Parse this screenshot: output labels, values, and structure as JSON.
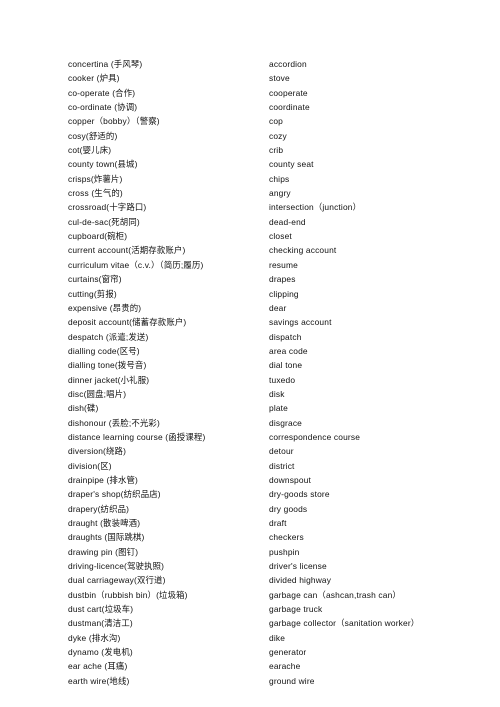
{
  "document": {
    "type": "vocabulary-list",
    "description": "British English to American English word list with Chinese glosses",
    "background_color": "#ffffff",
    "text_color": "#111111"
  },
  "columns": {
    "left_header": "",
    "right_header": ""
  },
  "rows": [
    {
      "british": "concertina (手风琴)",
      "american": "accordion"
    },
    {
      "british": "cooker (炉具)",
      "american": "stove"
    },
    {
      "british": "co-operate (合作)",
      "american": "cooperate"
    },
    {
      "british": "co-ordinate (协调)",
      "american": "coordinate"
    },
    {
      "british": "copper（bobby）（警察)",
      "american": "cop"
    },
    {
      "british": "cosy(舒适的)",
      "american": "cozy"
    },
    {
      "british": "cot(婴儿床)",
      "american": "crib"
    },
    {
      "british": "county town(县城)",
      "american": "county seat"
    },
    {
      "british": "crisps(炸薯片)",
      "american": "chips"
    },
    {
      "british": "cross (生气的)",
      "american": "angry"
    },
    {
      "british": "crossroad(十字路口)",
      "american": "intersection（junction）"
    },
    {
      "british": "cul-de-sac(死胡同)",
      "american": "dead-end"
    },
    {
      "british": "cupboard(碗柜)",
      "american": "closet"
    },
    {
      "british": "current account(活期存款账户)",
      "american": "checking account"
    },
    {
      "british": "curriculum vitae（c.v.）（简历;履历)",
      "american": "resume"
    },
    {
      "british": "curtains(窗帘)",
      "american": "drapes"
    },
    {
      "british": "cutting(剪报)",
      "american": "clipping"
    },
    {
      "british": "expensive (昂贵的)",
      "american": "dear"
    },
    {
      "british": "deposit account(储蓄存款账户)",
      "american": "savings account"
    },
    {
      "british": "despatch (派遣;发送)",
      "american": "dispatch"
    },
    {
      "british": "dialling code(区号)",
      "american": "area code"
    },
    {
      "british": "dialling tone(拨号音)",
      "american": "dial tone"
    },
    {
      "british": "dinner jacket(小礼服)",
      "american": "tuxedo"
    },
    {
      "british": "disc(圆盘;唱片)",
      "american": "disk"
    },
    {
      "british": "dish(碟)",
      "american": "plate"
    },
    {
      "british": "dishonour (丢脸;不光彩)",
      "american": "disgrace"
    },
    {
      "british": "distance learning course (函授课程)",
      "american": "correspondence course"
    },
    {
      "british": "diversion(绕路)",
      "american": "detour"
    },
    {
      "british": "division(区)",
      "american": "district"
    },
    {
      "british": "drainpipe (排水管)",
      "american": "downspout"
    },
    {
      "british": "draper's shop(纺织品店)",
      "american": "dry-goods store"
    },
    {
      "british": "drapery(纺织品)",
      "american": "dry goods"
    },
    {
      "british": "draught (散装啤酒)",
      "american": "draft"
    },
    {
      "british": "draughts (国际跳棋)",
      "american": "checkers"
    },
    {
      "british": "drawing pin (图钉)",
      "american": "pushpin"
    },
    {
      "british": "driving-licence(驾驶执照)",
      "american": "driver's license"
    },
    {
      "british": "dual carriageway(双行道)",
      "american": "divided highway"
    },
    {
      "british": "dustbin（rubbish bin）(垃圾箱)",
      "american": "garbage can（ashcan,trash can）"
    },
    {
      "british": "dust cart(垃圾车)",
      "american": "garbage truck"
    },
    {
      "british": "dustman(清洁工)",
      "american": "garbage collector（sanitation worker）"
    },
    {
      "british": "dyke (排水沟)",
      "american": "dike"
    },
    {
      "british": "dynamo (发电机)",
      "american": "generator"
    },
    {
      "british": "ear ache (耳痛)",
      "american": "earache"
    },
    {
      "british": "earth wire(地线)",
      "american": "ground wire"
    }
  ]
}
